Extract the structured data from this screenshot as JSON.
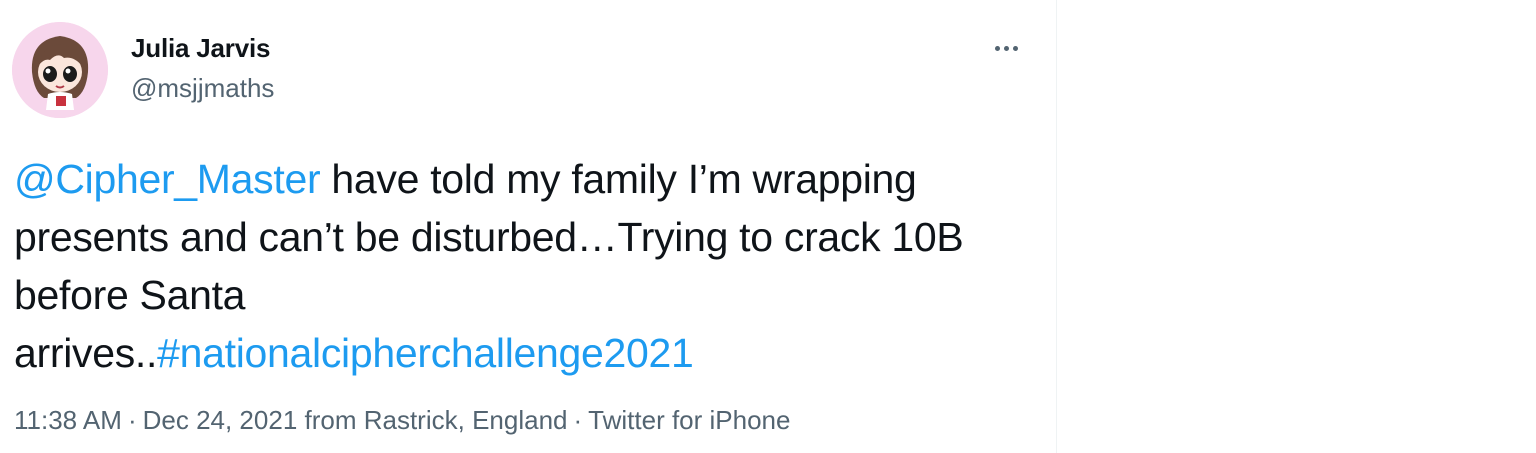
{
  "author": {
    "name": "Julia Jarvis",
    "handle": "@msjjmaths",
    "avatar_icon": "cartoon-girl-avatar"
  },
  "more_icon": "more-horizontal-icon",
  "tweet": {
    "mention": "@Cipher_Master",
    "text_line1": " have told my family I’m wrapping presents and can’t be disturbed…Trying to crack 10B before Santa",
    "text_line2": "arrives..",
    "hashtag": "#nationalcipherchallenge2021"
  },
  "meta": {
    "time": "11:38 AM",
    "separator": "·",
    "date_location": "Dec 24, 2021 from Rastrick, England",
    "source": "Twitter for iPhone"
  },
  "colors": {
    "link": "#1d9bf0",
    "text": "#0f1419",
    "secondary": "#536471"
  }
}
